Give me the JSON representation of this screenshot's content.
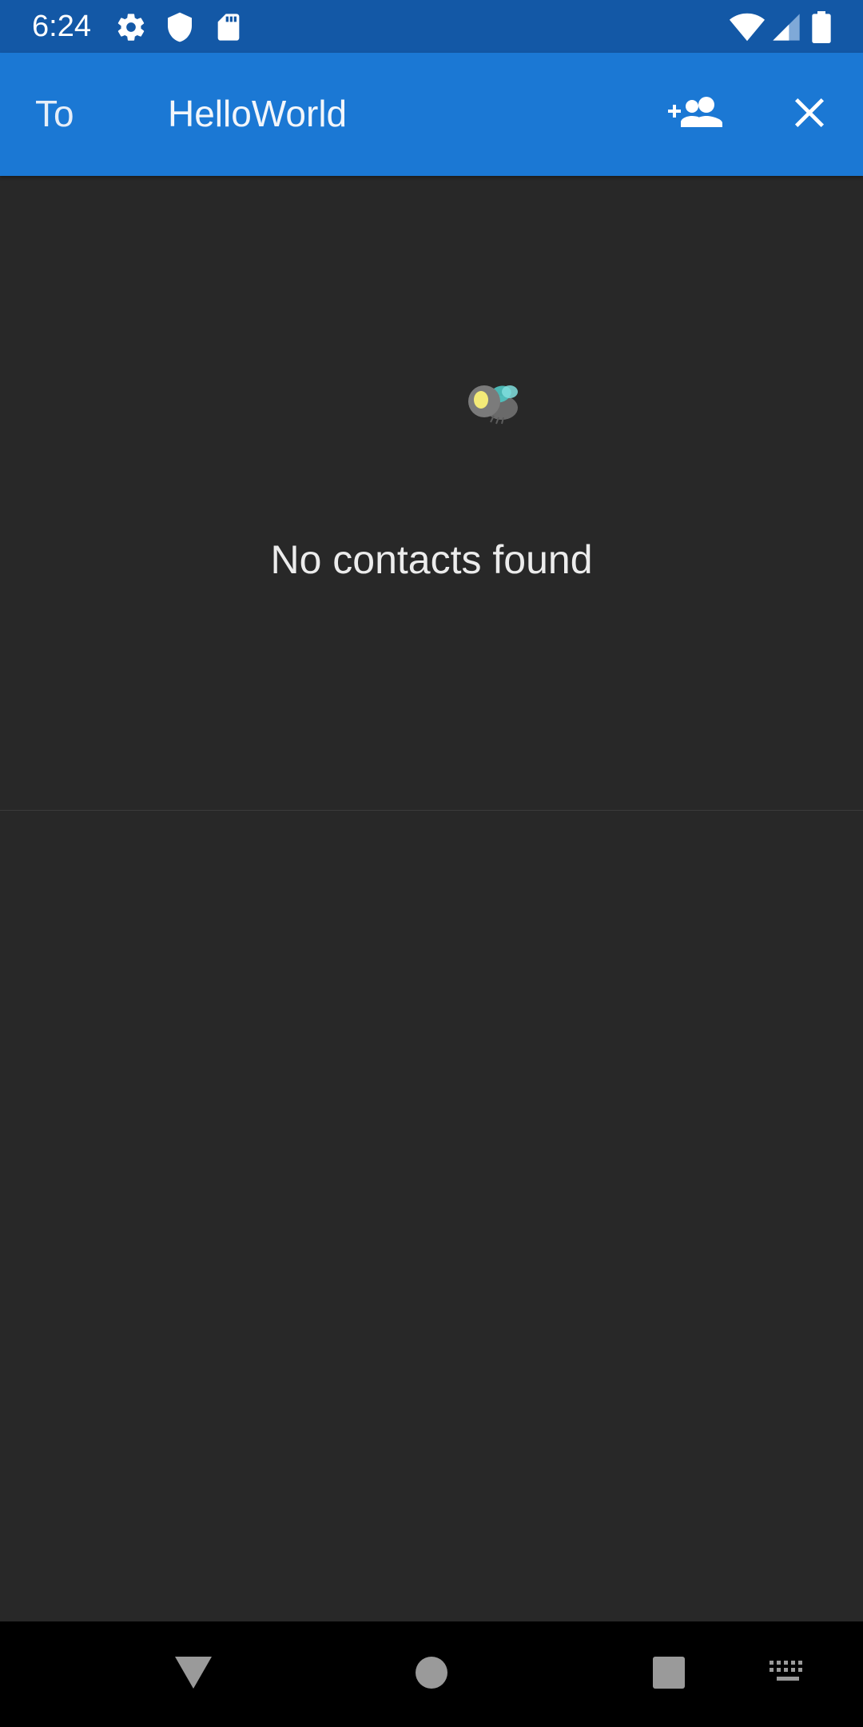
{
  "status_bar": {
    "time": "6:24",
    "left_icons": [
      "gear-icon",
      "shield-icon",
      "sd-card-icon"
    ],
    "right_icons": [
      "wifi-icon",
      "cell-signal-icon",
      "battery-icon"
    ],
    "background": "#1358a6"
  },
  "header": {
    "to_label": "To",
    "recipient_value": "HelloWorld",
    "add_contact_icon": "add-group-icon",
    "close_icon": "close-icon",
    "background": "#1b78d4"
  },
  "empty_state": {
    "illustration": "firefly-icon",
    "message": "No contacts found"
  },
  "nav_bar": {
    "back_icon": "back-triangle-icon",
    "home_icon": "home-circle-icon",
    "recents_icon": "recents-square-icon",
    "keyboard_icon": "keyboard-icon"
  }
}
